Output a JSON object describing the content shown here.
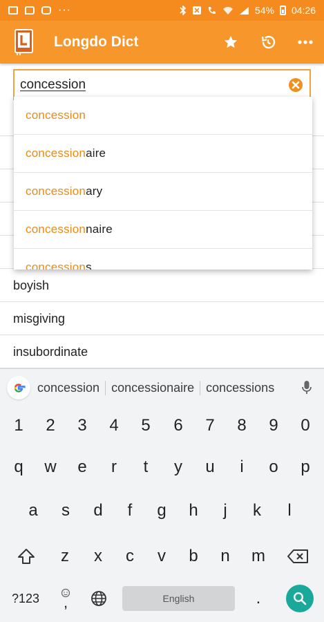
{
  "status_bar": {
    "battery_percent": "54%",
    "time": "04:26",
    "overflow_dots": "···"
  },
  "app_bar": {
    "title": "Longdo Dict",
    "logo_letter": "L",
    "actions": [
      {
        "name": "favorites",
        "icon": "star-icon"
      },
      {
        "name": "history",
        "icon": "history-icon"
      },
      {
        "name": "more",
        "icon": "more-icon"
      }
    ],
    "colors": {
      "accent": "#f7962b",
      "status": "#f58a1f"
    }
  },
  "search": {
    "value": "concession",
    "placeholder": ""
  },
  "suggestions": [
    {
      "match": "concession",
      "rest": ""
    },
    {
      "match": "concession",
      "rest": "aire"
    },
    {
      "match": "concession",
      "rest": "ary"
    },
    {
      "match": "concession",
      "rest": "naire"
    },
    {
      "match": "concession",
      "rest": "s"
    }
  ],
  "history": [
    "boyish",
    "misgiving",
    "insubordinate"
  ],
  "keyboard": {
    "suggestions": [
      "concession",
      "concessionaire",
      "concessions"
    ],
    "number_row": [
      "1",
      "2",
      "3",
      "4",
      "5",
      "6",
      "7",
      "8",
      "9",
      "0"
    ],
    "row1": [
      "q",
      "w",
      "e",
      "r",
      "t",
      "y",
      "u",
      "i",
      "o",
      "p"
    ],
    "row2": [
      "a",
      "s",
      "d",
      "f",
      "g",
      "h",
      "j",
      "k",
      "l"
    ],
    "row3": [
      "z",
      "x",
      "c",
      "v",
      "b",
      "n",
      "m"
    ],
    "symbols_label": "?123",
    "comma_label": ",",
    "space_label": "English",
    "period_label": "."
  }
}
